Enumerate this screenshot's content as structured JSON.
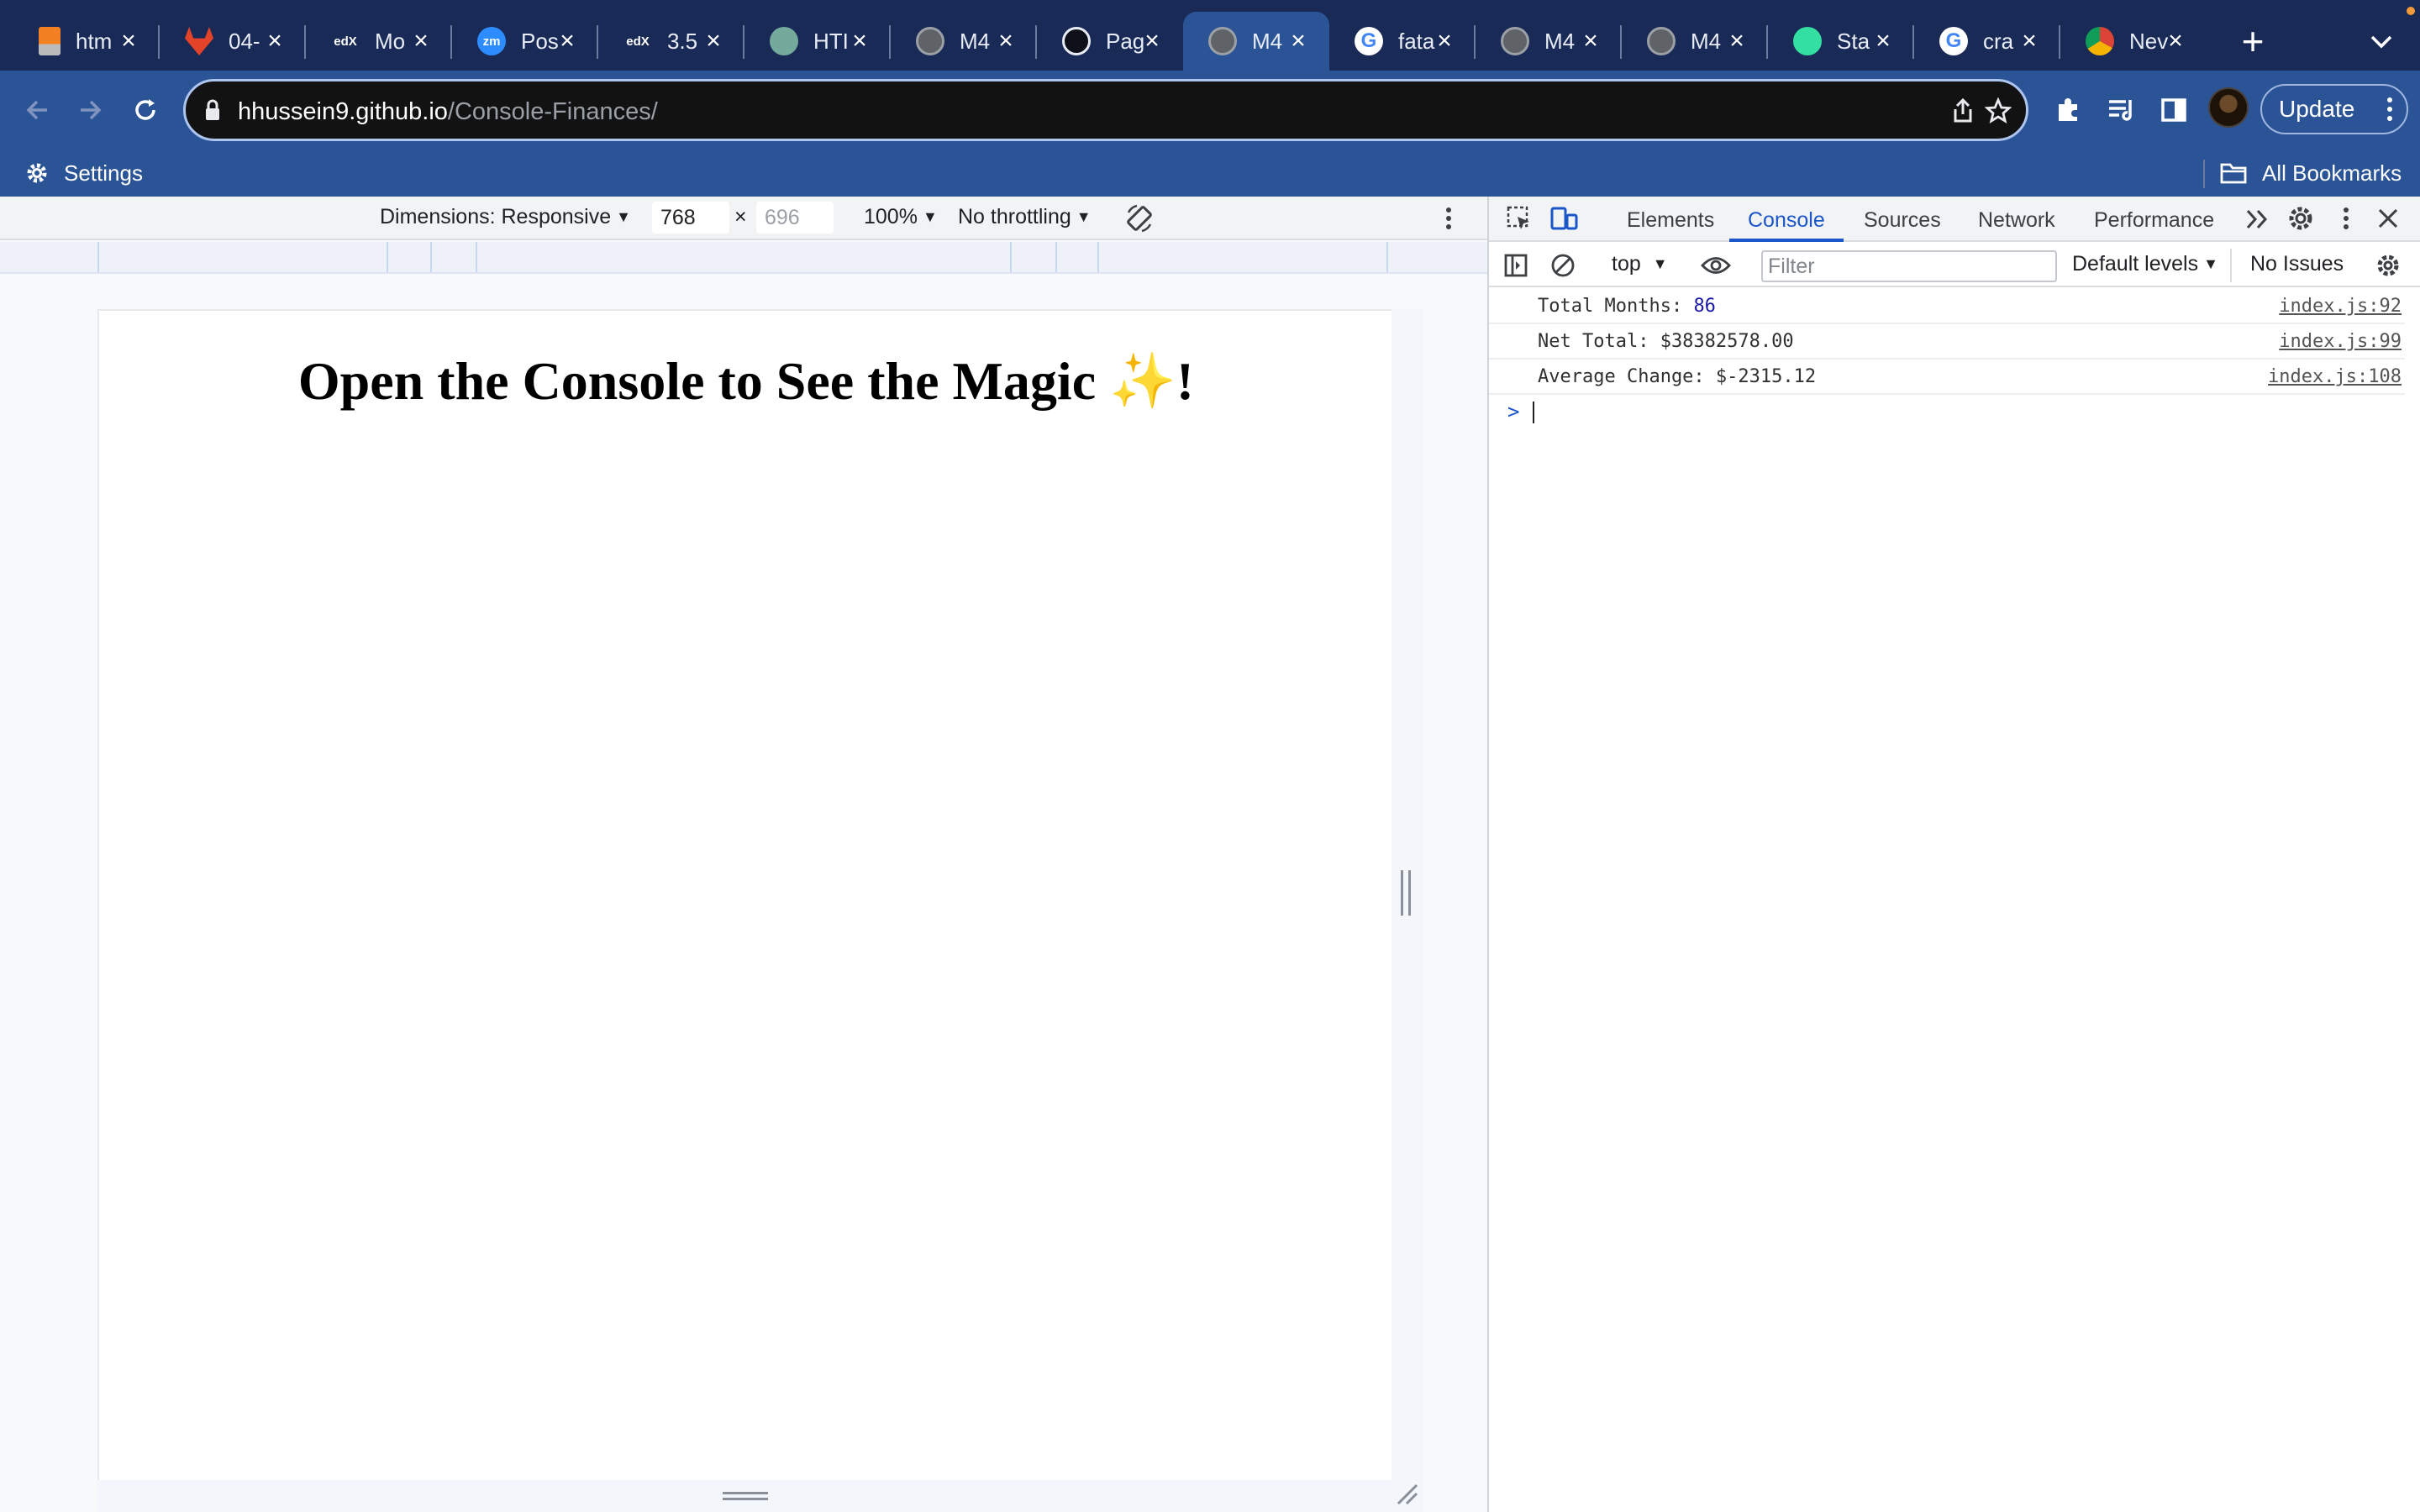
{
  "browser": {
    "tabs": [
      {
        "title": "htm",
        "favicon": "stackoverflow-icon",
        "color": "#f48024"
      },
      {
        "title": "04-",
        "favicon": "gitlab-icon",
        "color": "#e24329"
      },
      {
        "title": "Mo",
        "favicon": "edx-icon",
        "color": "#ffffff"
      },
      {
        "title": "Pos",
        "favicon": "zoom-icon",
        "color": "#2d8cff"
      },
      {
        "title": "3.5",
        "favicon": "edx-icon",
        "color": "#ffffff"
      },
      {
        "title": "HTI",
        "favicon": "chatgpt-icon",
        "color": "#74aa9c"
      },
      {
        "title": "M4",
        "favicon": "globe-icon",
        "color": "#9aa0a6"
      },
      {
        "title": "Pag",
        "favicon": "github-icon",
        "color": "#0d1117"
      },
      {
        "title": "M4",
        "favicon": "globe-icon",
        "color": "#9aa0a6",
        "active": true
      },
      {
        "title": "fata",
        "favicon": "google-icon",
        "color": "#ffffff"
      },
      {
        "title": "M4",
        "favicon": "globe-icon",
        "color": "#9aa0a6"
      },
      {
        "title": "M4",
        "favicon": "globe-icon",
        "color": "#9aa0a6"
      },
      {
        "title": "Sta",
        "favicon": "tripadvisor-icon",
        "color": "#34e0a1"
      },
      {
        "title": "cra",
        "favicon": "google-icon",
        "color": "#ffffff"
      },
      {
        "title": "Nev",
        "favicon": "chrome-icon",
        "color": "#ffffff"
      }
    ],
    "new_tab_label": "+",
    "url_host": "hhussein9.github.io",
    "url_path": "/Console-Finances/",
    "update_label": "Update",
    "bookmarks": {
      "settings_label": "Settings",
      "all_bookmarks_label": "All Bookmarks"
    }
  },
  "device_toolbar": {
    "dimensions_label": "Dimensions: Responsive",
    "width_value": "768",
    "times_sign": "×",
    "height_value": "696",
    "zoom": "100%",
    "throttling": "No throttling"
  },
  "page": {
    "heading_text": "Open the Console to See the Magic ",
    "heading_emoji": "✨",
    "heading_end": "!"
  },
  "devtools": {
    "tabs": [
      "Elements",
      "Console",
      "Sources",
      "Network",
      "Performance"
    ],
    "active_tab": "Console",
    "more_tabs": "»",
    "console_bar": {
      "context": "top",
      "filter_placeholder": "Filter",
      "levels": "Default levels",
      "issues": "No Issues"
    },
    "console_lines": [
      {
        "label": "Total Months: ",
        "value": "86",
        "source": "index.js:92"
      },
      {
        "label": "Net Total: $38382578.00",
        "value": "",
        "source": "index.js:99"
      },
      {
        "label": "Average Change: $-2315.12",
        "value": "",
        "source": "index.js:108"
      }
    ],
    "prompt_symbol": ">"
  },
  "colors": {
    "tabstrip": "#1a2a56",
    "toolbar": "#2b5496",
    "active_tab_accent": "#1a56c9"
  }
}
